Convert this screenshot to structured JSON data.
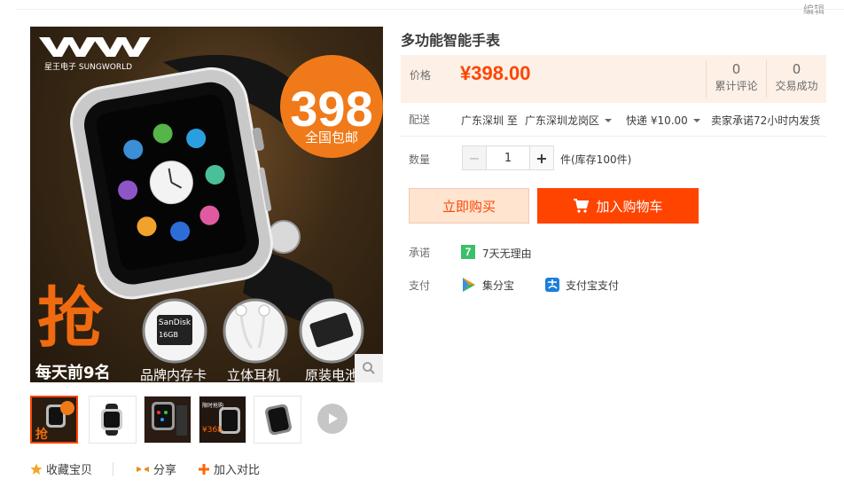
{
  "header": {
    "edit_label": "编辑"
  },
  "product": {
    "title": "多功能智能手表",
    "image": {
      "brand_text": "星王电子 SUNGWORLD",
      "badge_price": "398",
      "badge_sub": "全国包邮",
      "promo_big": "抢",
      "promo_sub": "每天前9名",
      "gifts": [
        "品牌内存卡",
        "立体耳机",
        "原装电池"
      ],
      "sd_brand": "SanDisk",
      "sd_size": "16GB"
    }
  },
  "price": {
    "label": "价格",
    "value": "¥398.00"
  },
  "stats": [
    {
      "count": "0",
      "label": "累计评论"
    },
    {
      "count": "0",
      "label": "交易成功"
    }
  ],
  "shipping": {
    "label": "配送",
    "from": "广东深圳 至",
    "to": "广东深圳龙岗区",
    "method": "快递 ¥10.00",
    "promise": "卖家承诺72小时内发货"
  },
  "quantity": {
    "label": "数量",
    "minus": "−",
    "plus": "+",
    "value": "1",
    "stock": "件(库存100件)"
  },
  "actions": {
    "buy_now": "立即购买",
    "add_to_cart": "加入购物车"
  },
  "promise": {
    "label": "承诺",
    "badge": "7",
    "text": "7天无理由"
  },
  "payment": {
    "label": "支付",
    "methods": [
      "集分宝",
      "支付宝支付"
    ]
  },
  "social": {
    "favorite": "收藏宝贝",
    "share": "分享",
    "compare": "加入对比"
  },
  "colors": {
    "accent": "#ff4400",
    "price_bg": "#fdf0e6",
    "buy_bg": "#ffe4d0",
    "promise_green": "#3cbf6a"
  },
  "icons": [
    "search-icon",
    "play-icon",
    "cart-icon",
    "star-icon",
    "share-icon",
    "plus-icon",
    "jifenbao-icon",
    "alipay-icon"
  ]
}
